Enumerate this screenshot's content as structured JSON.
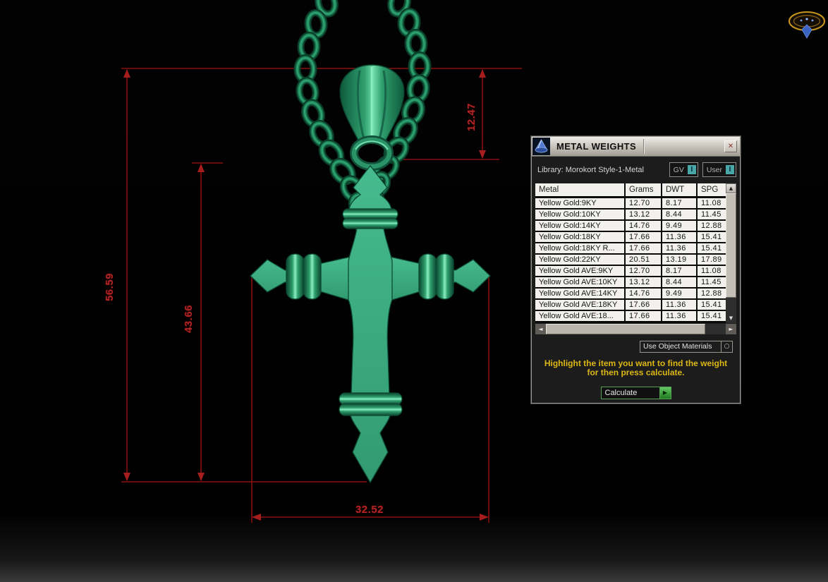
{
  "viewport": {
    "dimensions": {
      "bail_height": "12.47",
      "total_height": "56.59",
      "cross_height": "43.66",
      "cross_width": "32.52"
    },
    "colors": {
      "dimension_red": "#8a1010",
      "label_red": "#b32525",
      "model_green": "#3bab80",
      "instruction_yellow": "#dcb714"
    }
  },
  "icons": {
    "close": "✕",
    "scroll_up": "▲",
    "scroll_down": "▼",
    "scroll_left": "◄",
    "scroll_right": "►",
    "play": "▶",
    "radio": "○"
  },
  "dialog": {
    "title": "METAL WEIGHTS",
    "library": "Library: Morokort Style-1-Metal",
    "gv_label": "GV",
    "user_label": "User",
    "toggle_glyph": "I",
    "table": {
      "headers": [
        "Metal",
        "Grams",
        "DWT",
        "SPG"
      ],
      "rows": [
        {
          "metal": "Yellow Gold:9KY",
          "grams": "12.70",
          "dwt": "8.17",
          "spg": "11.08"
        },
        {
          "metal": "Yellow Gold:10KY",
          "grams": "13.12",
          "dwt": "8.44",
          "spg": "11.45"
        },
        {
          "metal": "Yellow Gold:14KY",
          "grams": "14.76",
          "dwt": "9.49",
          "spg": "12.88"
        },
        {
          "metal": "Yellow Gold:18KY",
          "grams": "17.66",
          "dwt": "11.36",
          "spg": "15.41"
        },
        {
          "metal": "Yellow Gold:18KY R...",
          "grams": "17.66",
          "dwt": "11.36",
          "spg": "15.41"
        },
        {
          "metal": "Yellow Gold:22KY",
          "grams": "20.51",
          "dwt": "13.19",
          "spg": "17.89"
        },
        {
          "metal": "Yellow Gold AVE:9KY",
          "grams": "12.70",
          "dwt": "8.17",
          "spg": "11.08"
        },
        {
          "metal": "Yellow Gold AVE:10KY",
          "grams": "13.12",
          "dwt": "8.44",
          "spg": "11.45"
        },
        {
          "metal": "Yellow Gold AVE:14KY",
          "grams": "14.76",
          "dwt": "9.49",
          "spg": "12.88"
        },
        {
          "metal": "Yellow Gold AVE:18KY",
          "grams": "17.66",
          "dwt": "11.36",
          "spg": "15.41"
        },
        {
          "metal": "Yellow Gold AVE:18...",
          "grams": "17.66",
          "dwt": "11.36",
          "spg": "15.41"
        }
      ]
    },
    "materials_selector_label": "Use Object Materials",
    "instruction": [
      "Highlight the item you want to find the weight",
      "for then press calculate."
    ],
    "calculate_label": "Calculate"
  }
}
